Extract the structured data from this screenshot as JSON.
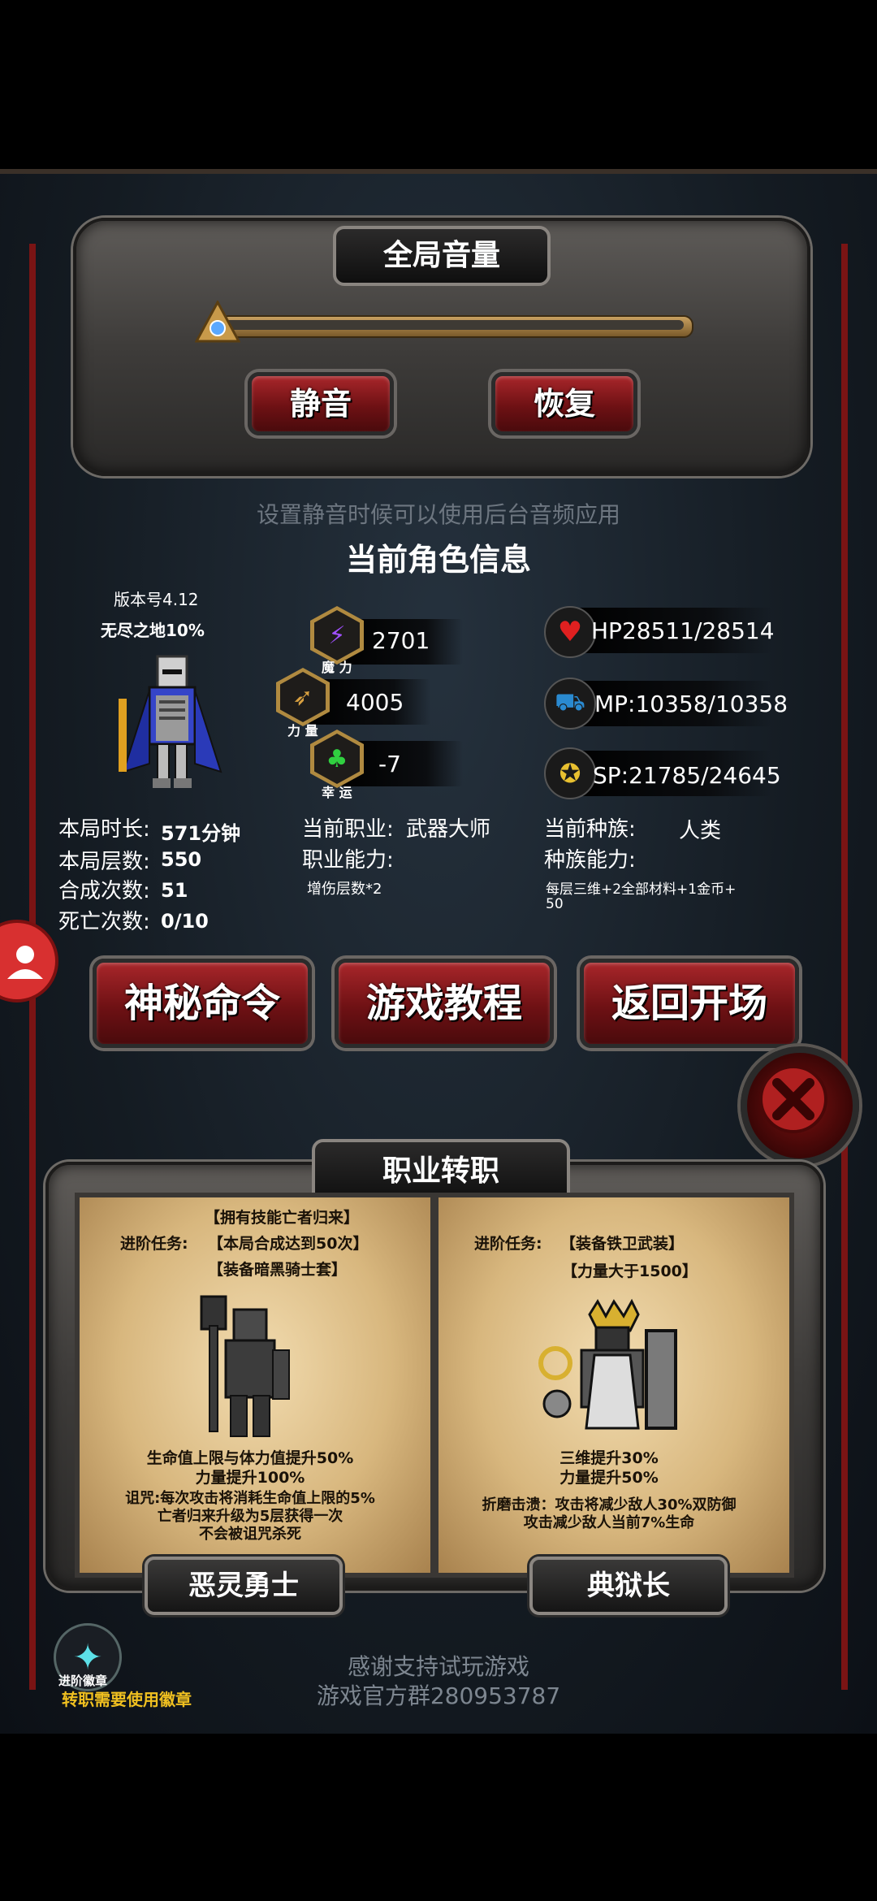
{
  "volume": {
    "title": "全局音量",
    "mute_label": "静音",
    "restore_label": "恢复",
    "hint": "设置静音时候可以使用后台音频应用"
  },
  "char_info": {
    "title": "当前角色信息",
    "version": "版本号4.12",
    "mode": "无尽之地10%",
    "magic": {
      "value": "2701",
      "label": "魔 力"
    },
    "strength": {
      "value": "4005",
      "label": "力 量"
    },
    "luck": {
      "value": "-7",
      "label": "幸 运"
    },
    "hp": "HP28511/28514",
    "mp": "MP:10358/10358",
    "sp": "SP:21785/24645",
    "run_time_label": "本局时长:",
    "run_time_value": "571分钟",
    "floors_label": "本局层数:",
    "floors_value": "550",
    "synth_label": "合成次数:",
    "synth_value": "51",
    "death_label": "死亡次数:",
    "death_value": "0/10",
    "job_label": "当前职业:",
    "job_value": "武器大师",
    "job_ability_label": "职业能力:",
    "job_ability_value": "增伤层数*2",
    "race_label": "当前种族:",
    "race_value": "人类",
    "race_ability_label": "种族能力:",
    "race_ability_value": "每层三维+2全部材料+1金币+\n50"
  },
  "buttons": {
    "secret": "神秘命令",
    "tutorial": "游戏教程",
    "back": "返回开场"
  },
  "job_change": {
    "title": "职业转职",
    "left": {
      "req1": "【拥有技能亡者归来】",
      "task_label": "进阶任务:",
      "req2": "【本局合成达到50次】",
      "req3": "【装备暗黑骑士套】",
      "effect1": "生命值上限与体力值提升50%",
      "effect2": "力量提升100%",
      "effect3": "诅咒:每次攻击将消耗生命值上限的5%",
      "effect4": "亡者归来升级为5层获得一次",
      "effect5": "不会被诅咒杀死",
      "name": "恶灵勇士"
    },
    "right": {
      "task_label": "进阶任务:",
      "req1": "【装备铁卫武装】",
      "req2": "【力量大于1500】",
      "effect1": "三维提升30%",
      "effect2": "力量提升50%",
      "effect3": "折磨击溃：攻击将减少敌人30%双防御",
      "effect4": "攻击减少敌人当前7%生命",
      "name": "典狱长"
    },
    "badge_label": "进阶徽章",
    "badge_note": "转职需要使用徽章"
  },
  "footer": {
    "line1": "感谢支持试玩游戏",
    "line2": "游戏官方群280953787"
  }
}
